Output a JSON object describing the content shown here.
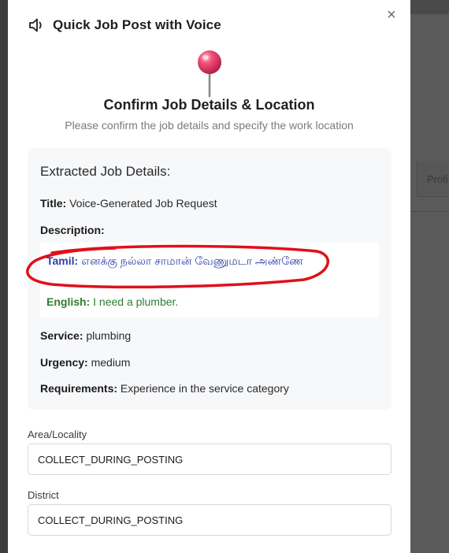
{
  "backdrop": {
    "tab_label": "Profi"
  },
  "modal": {
    "title": "Quick Job Post with Voice",
    "close_label": "×",
    "confirm_title": "Confirm Job Details & Location",
    "confirm_subtitle": "Please confirm the job details and specify the work location"
  },
  "details": {
    "heading": "Extracted Job Details:",
    "title_label": "Title:",
    "title_value": "Voice-Generated Job Request",
    "description_label": "Description:",
    "tamil_label": "Tamil:",
    "tamil_value": "எனக்கு நல்லா சாமான் வேணுமடா அண்ணே",
    "english_label": "English:",
    "english_value": "I need a plumber.",
    "service_label": "Service:",
    "service_value": "plumbing",
    "urgency_label": "Urgency:",
    "urgency_value": "medium",
    "requirements_label": "Requirements:",
    "requirements_value": "Experience in the service category"
  },
  "location": {
    "area_label": "Area/Locality",
    "area_value": "COLLECT_DURING_POSTING",
    "district_label": "District",
    "district_value": "COLLECT_DURING_POSTING"
  },
  "colors": {
    "tamil_text": "#2d3fa7",
    "english_text": "#2e7d32",
    "annotation": "#e0101a",
    "pin": "#e8305a"
  }
}
